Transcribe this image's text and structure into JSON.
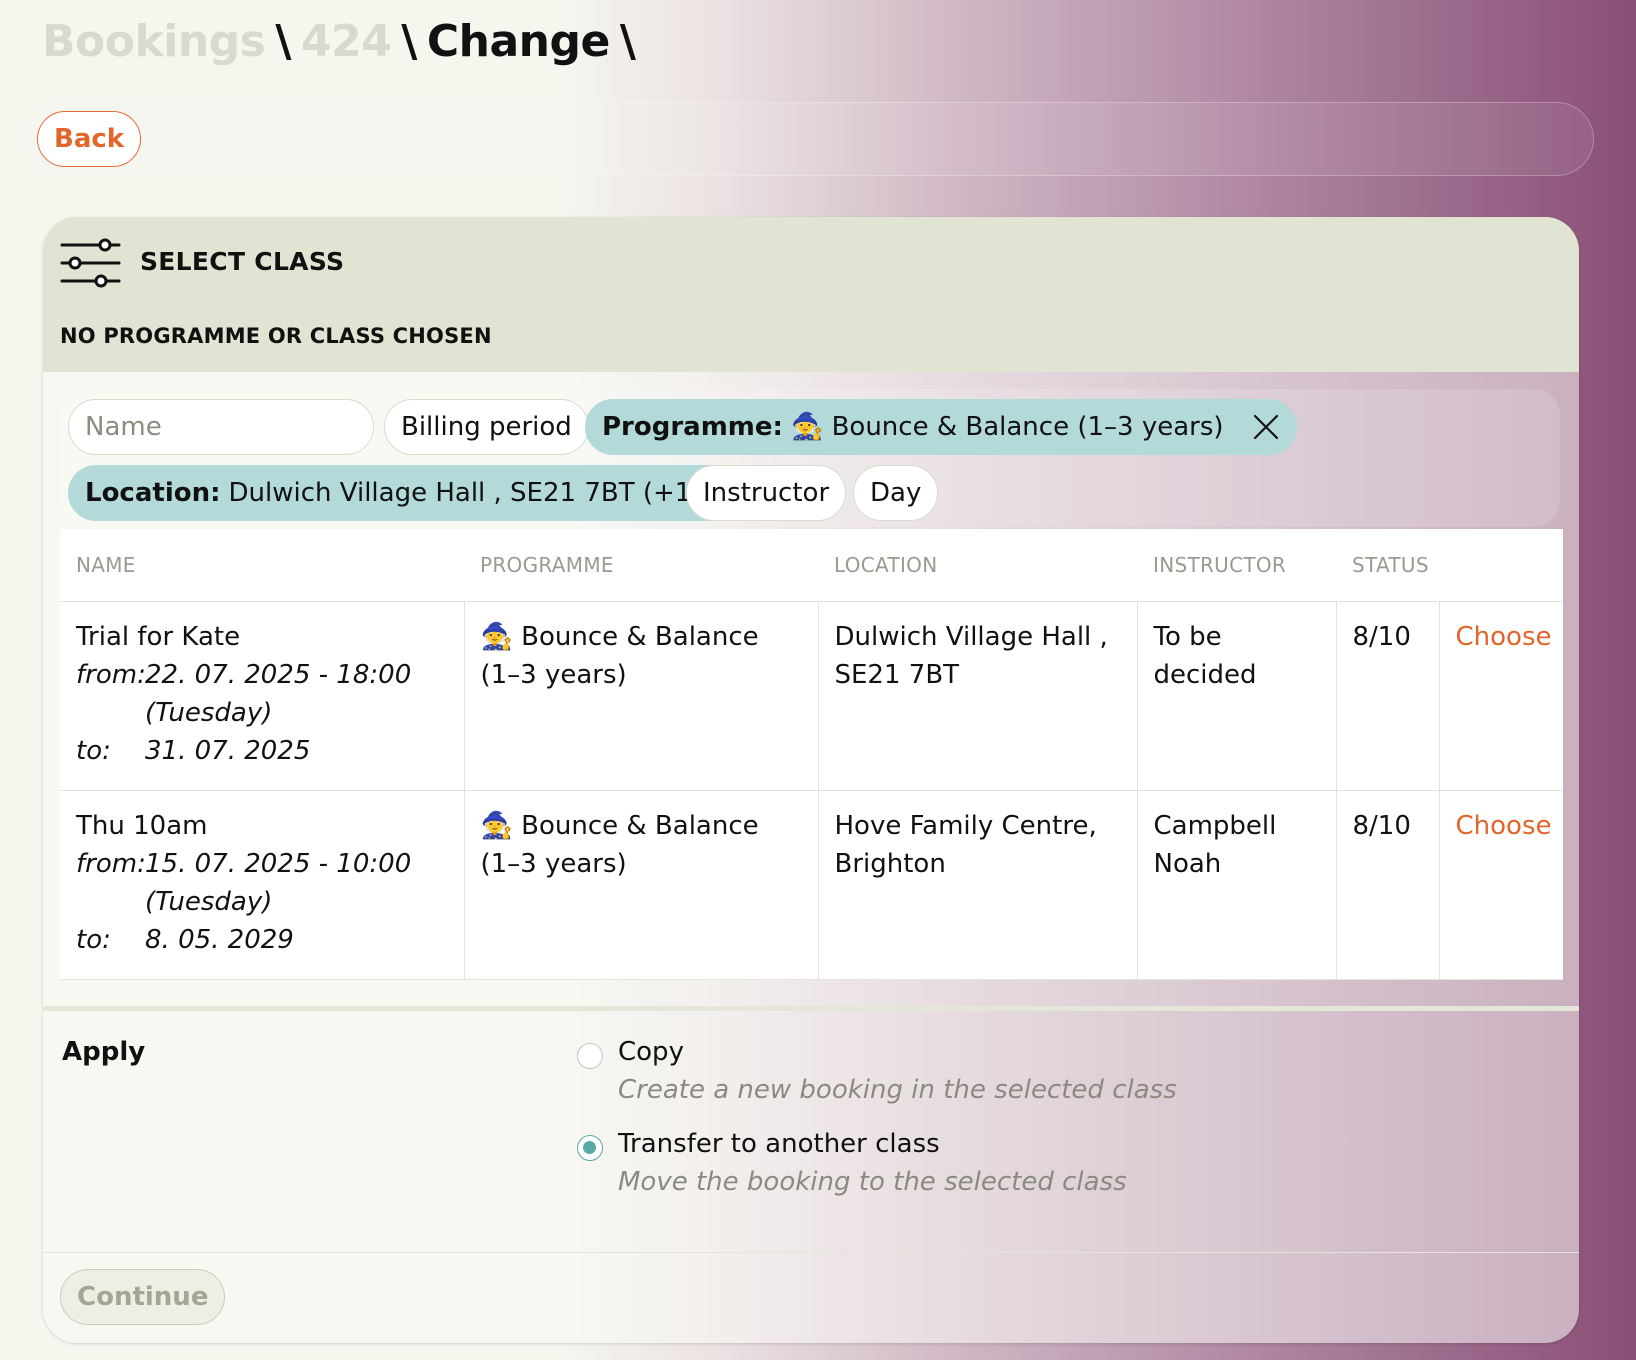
{
  "breadcrumb": {
    "bookings": "Bookings",
    "sep1": "\\",
    "booking_id": "424",
    "sep2": "\\",
    "current": "Change",
    "sep3": "\\"
  },
  "toolbar": {
    "back_label": "Back"
  },
  "panel": {
    "title": "SELECT CLASS",
    "subtitle": "NO PROGRAMME OR CLASS CHOSEN"
  },
  "filters": {
    "name_placeholder": "Name",
    "billing_period": "Billing period",
    "programme_key": "Programme:",
    "programme_value": "🧙 Bounce & Balance (1–3 years)",
    "location_key": "Location:",
    "location_value": "Dulwich Village Hall , SE21 7BT (+1)",
    "instructor": "Instructor",
    "day": "Day"
  },
  "table": {
    "headers": {
      "name": "NAME",
      "programme": "PROGRAMME",
      "location": "LOCATION",
      "instructor": "INSTRUCTOR",
      "status": "STATUS"
    },
    "rows": [
      {
        "name": "Trial for Kate",
        "from_label": "from:",
        "from": "22. 07. 2025 - 18:00",
        "weekday": "(Tuesday)",
        "to_label": "to:",
        "to": "31. 07. 2025",
        "programme": "🧙 Bounce & Balance (1–3 years)",
        "location": "Dulwich Village Hall , SE21 7BT",
        "instructor": "To be decided",
        "status": "8/10",
        "action": "Choose"
      },
      {
        "name": "Thu 10am",
        "from_label": "from:",
        "from": "15. 07. 2025 - 10:00",
        "weekday": "(Tuesday)",
        "to_label": "to:",
        "to": "8. 05. 2029",
        "programme": "🧙 Bounce & Balance (1–3 years)",
        "location": "Hove Family Centre, Brighton",
        "instructor": "Campbell Noah",
        "status": "8/10",
        "action": "Choose"
      }
    ]
  },
  "apply": {
    "label": "Apply",
    "options": [
      {
        "label": "Copy",
        "description": "Create a new booking in the selected class",
        "checked": false
      },
      {
        "label": "Transfer to another class",
        "description": "Move the booking to the selected class",
        "checked": true
      }
    ]
  },
  "footer": {
    "continue_label": "Continue"
  },
  "colors": {
    "accent": "#e0662c",
    "chip_active": "#b3d9d9",
    "header_bg": "#e1e4d2",
    "radio": "#5aa8a8"
  }
}
